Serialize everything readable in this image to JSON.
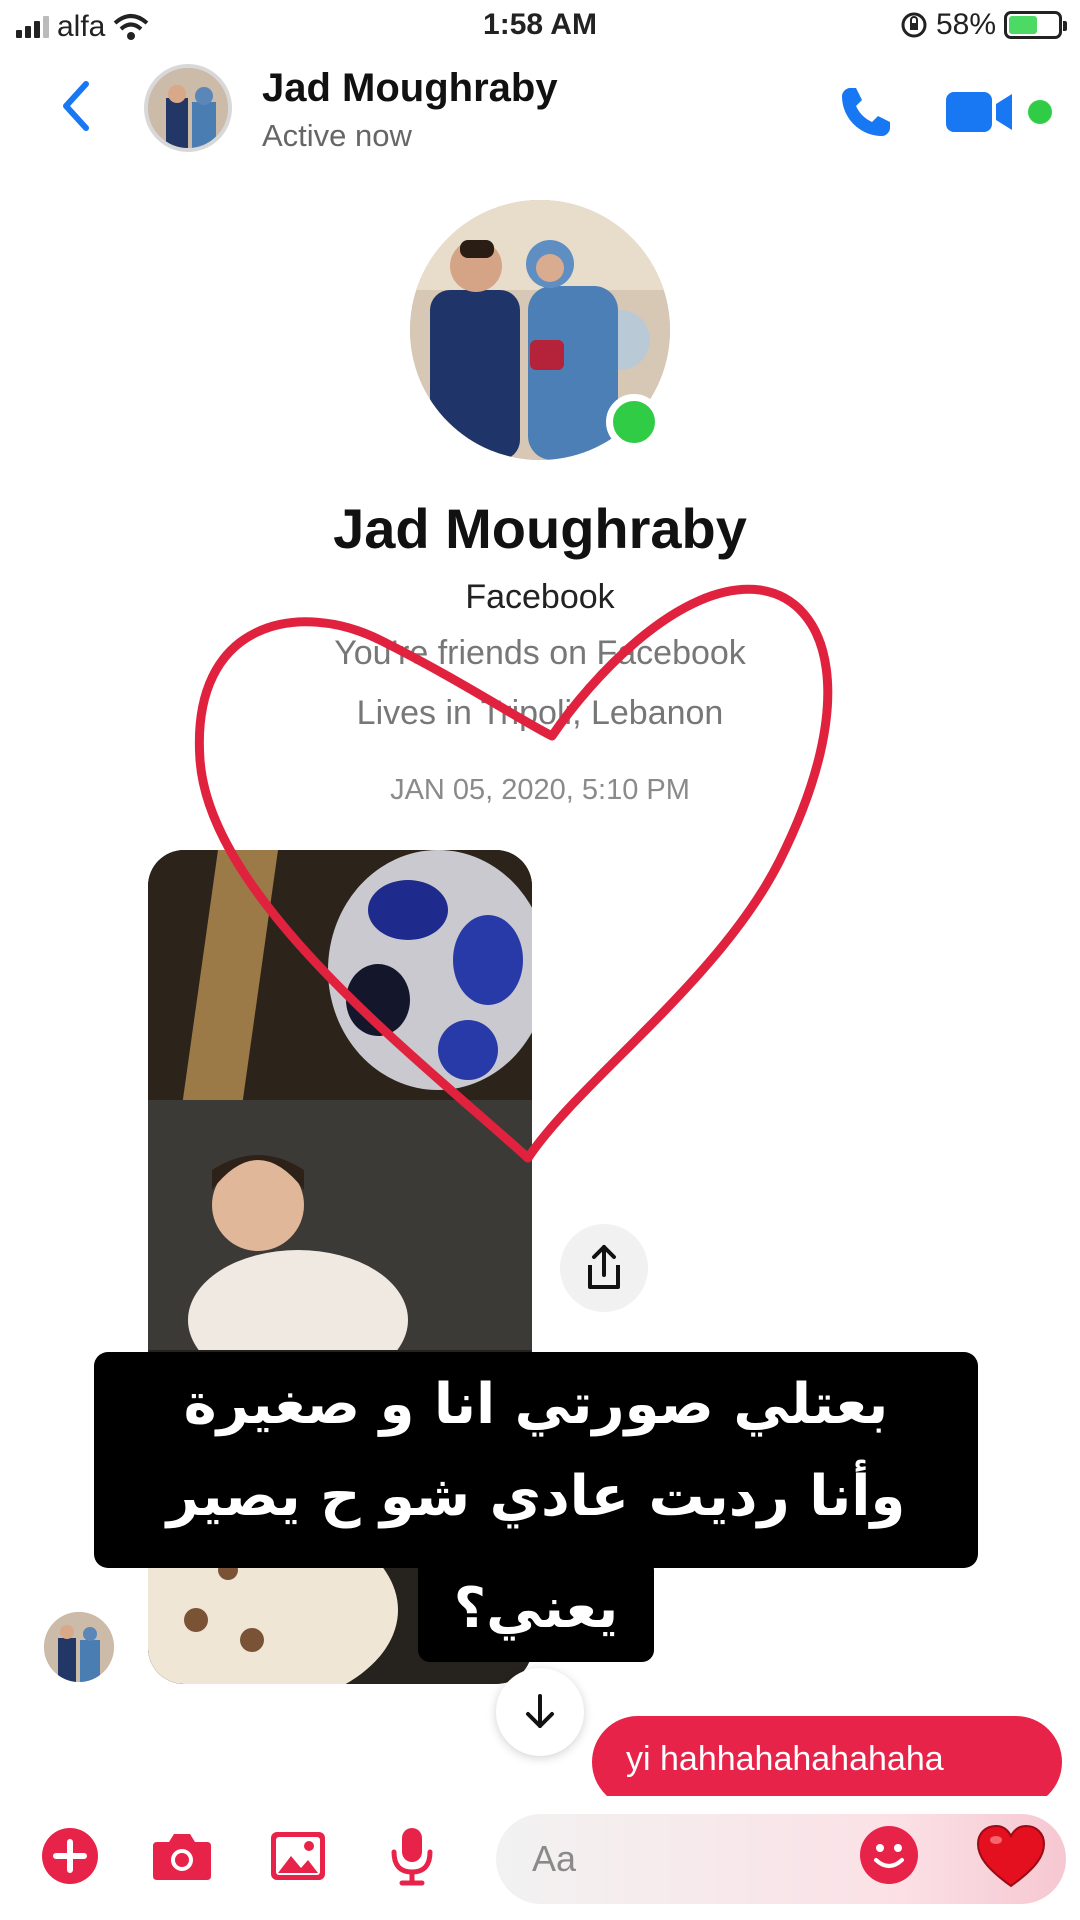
{
  "status_bar": {
    "carrier": "alfa",
    "time": "1:58 AM",
    "battery_percent": "58%",
    "battery_level": 0.58,
    "icons": [
      "signal-icon",
      "wifi-icon",
      "orientation-lock-icon",
      "battery-charging-icon"
    ]
  },
  "header": {
    "contact_name": "Jad Moughraby",
    "status": "Active now",
    "icons": [
      "back-chevron-icon",
      "phone-icon",
      "video-camera-icon"
    ]
  },
  "profile": {
    "name": "Jad Moughraby",
    "source": "Facebook",
    "friends_line": "You're friends on Facebook",
    "location": "Lives in Tripoli, Lebanon",
    "online": true
  },
  "conversation": {
    "timestamp": "JAN 05, 2020, 5:10 PM",
    "outgoing_message": "yi hahhahahahahaha"
  },
  "caption_overlay": {
    "line1": "بعتلي صورتي انا و صغيرة",
    "line2": "وأنا رديت عادي شو ح يصير",
    "line3": "يعني؟"
  },
  "composer": {
    "placeholder": "Aa",
    "icons": [
      "plus-icon",
      "camera-icon",
      "gallery-icon",
      "microphone-icon",
      "emoji-icon",
      "heart-icon"
    ]
  },
  "colors": {
    "accent_blue": "#1877f2",
    "accent_red": "#e8234a",
    "online_green": "#31cc46",
    "heart_doodle": "#e0223f"
  }
}
